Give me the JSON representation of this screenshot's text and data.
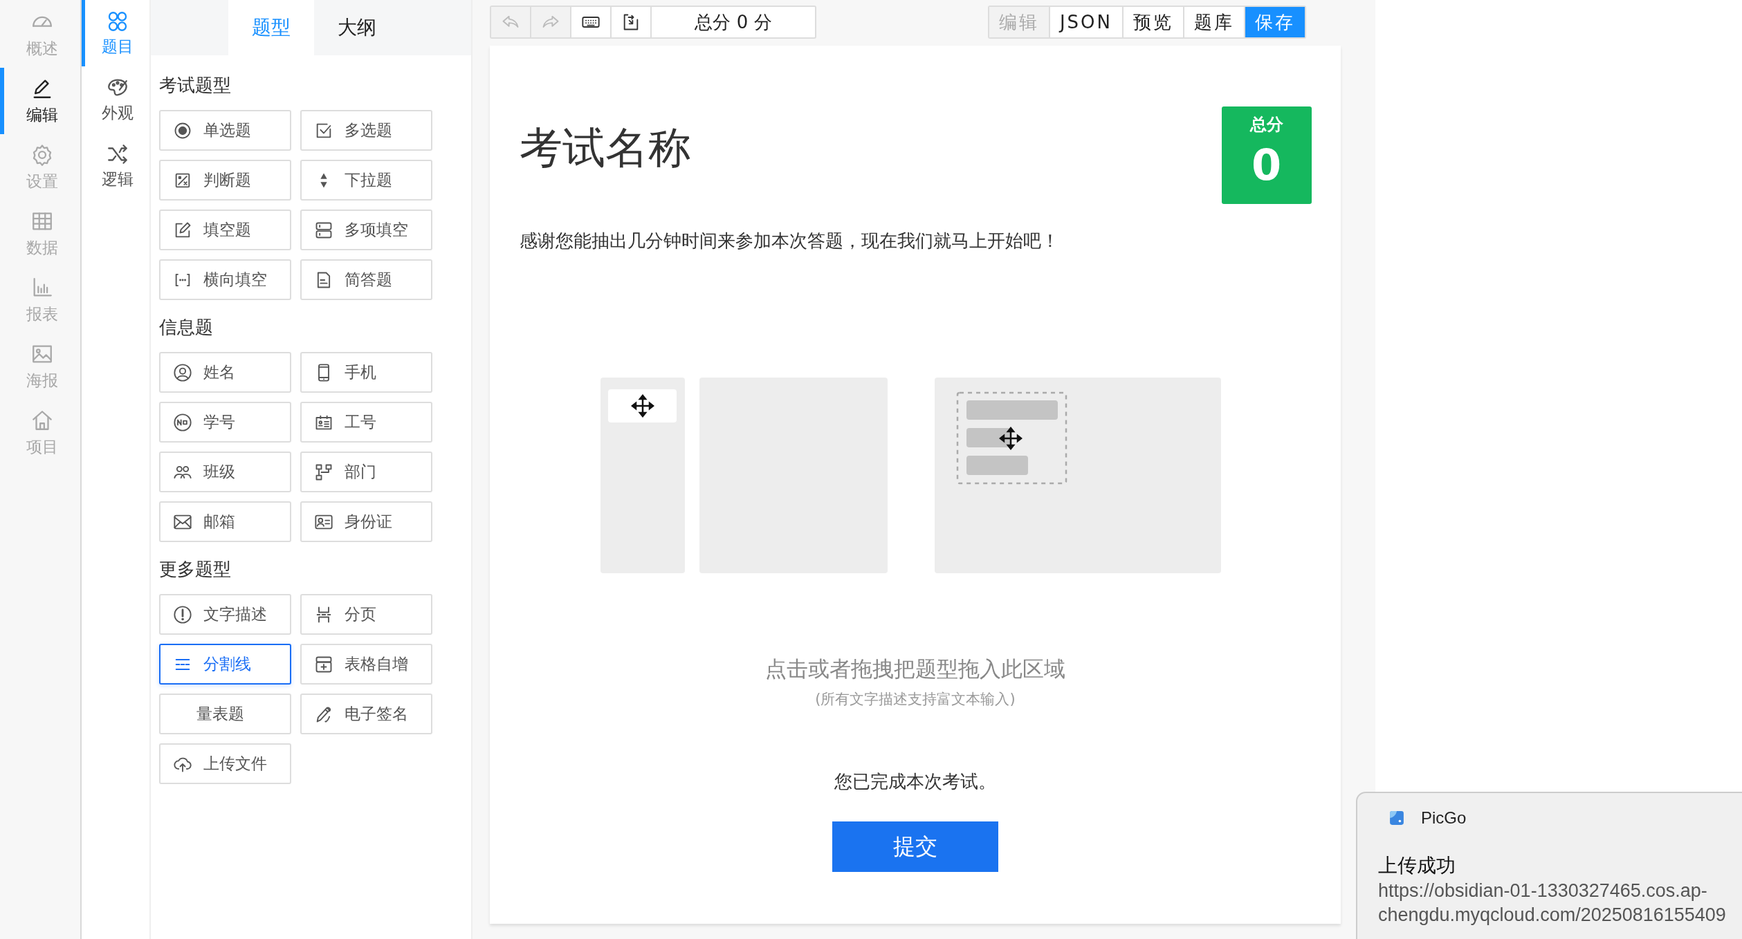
{
  "nav_primary": [
    {
      "label": "概述",
      "selected": false
    },
    {
      "label": "编辑",
      "selected": true
    },
    {
      "label": "设置",
      "selected": false
    },
    {
      "label": "数据",
      "selected": false
    },
    {
      "label": "报表",
      "selected": false
    },
    {
      "label": "海报",
      "selected": false
    },
    {
      "label": "项目",
      "selected": false
    }
  ],
  "nav_secondary": [
    {
      "label": "题目",
      "selected": true
    },
    {
      "label": "外观",
      "selected": false
    },
    {
      "label": "逻辑",
      "selected": false
    }
  ],
  "palette_tabs": [
    {
      "label": "题型",
      "selected": true
    },
    {
      "label": "大纲",
      "selected": false
    }
  ],
  "palette_sections": [
    {
      "title": "考试题型",
      "items": [
        {
          "label": "单选题",
          "selected": false
        },
        {
          "label": "多选题",
          "selected": false
        },
        {
          "label": "判断题",
          "selected": false
        },
        {
          "label": "下拉题",
          "selected": false
        },
        {
          "label": "填空题",
          "selected": false
        },
        {
          "label": "多项填空",
          "selected": false
        },
        {
          "label": "横向填空",
          "selected": false
        },
        {
          "label": "简答题",
          "selected": false
        }
      ]
    },
    {
      "title": "信息题",
      "items": [
        {
          "label": "姓名",
          "selected": false
        },
        {
          "label": "手机",
          "selected": false
        },
        {
          "label": "学号",
          "selected": false
        },
        {
          "label": "工号",
          "selected": false
        },
        {
          "label": "班级",
          "selected": false
        },
        {
          "label": "部门",
          "selected": false
        },
        {
          "label": "邮箱",
          "selected": false
        },
        {
          "label": "身份证",
          "selected": false
        }
      ]
    },
    {
      "title": "更多题型",
      "items": [
        {
          "label": "文字描述",
          "selected": false
        },
        {
          "label": "分页",
          "selected": false
        },
        {
          "label": "分割线",
          "selected": true
        },
        {
          "label": "表格自增",
          "selected": false
        },
        {
          "label": "量表题",
          "selected": false
        },
        {
          "label": "电子签名",
          "selected": false
        },
        {
          "label": "上传文件",
          "selected": false
        }
      ]
    }
  ],
  "toolbar": {
    "tools": [
      {
        "disabled": true
      },
      {
        "disabled": true
      },
      {
        "disabled": false
      },
      {
        "disabled": false
      }
    ],
    "score": "总分 0 分",
    "actions": [
      {
        "label": "编辑",
        "kind": "default",
        "disabled": true
      },
      {
        "label": "JSON",
        "kind": "default",
        "disabled": false
      },
      {
        "label": "预览",
        "kind": "default",
        "disabled": false
      },
      {
        "label": "题库",
        "kind": "default",
        "disabled": false
      },
      {
        "label": "保存",
        "kind": "primary",
        "disabled": false
      }
    ]
  },
  "form": {
    "title": "考试名称",
    "score_badge": {
      "label": "总分",
      "value": "0"
    },
    "description": "感谢您能抽出几分钟时间来参加本次答题，现在我们就马上开始吧！",
    "dropzone_hint": "点击或者拖拽把题型拖入此区域",
    "dropzone_subhint": "(所有文字描述支持富文本输入)",
    "completion": "您已完成本次考试。",
    "submit": "提交"
  },
  "notification": {
    "app": "PicGo",
    "title": "上传成功",
    "body": "https://obsidian-01-1330327465.cos.ap-chengdu.myqcloud.com/20250816155409"
  }
}
